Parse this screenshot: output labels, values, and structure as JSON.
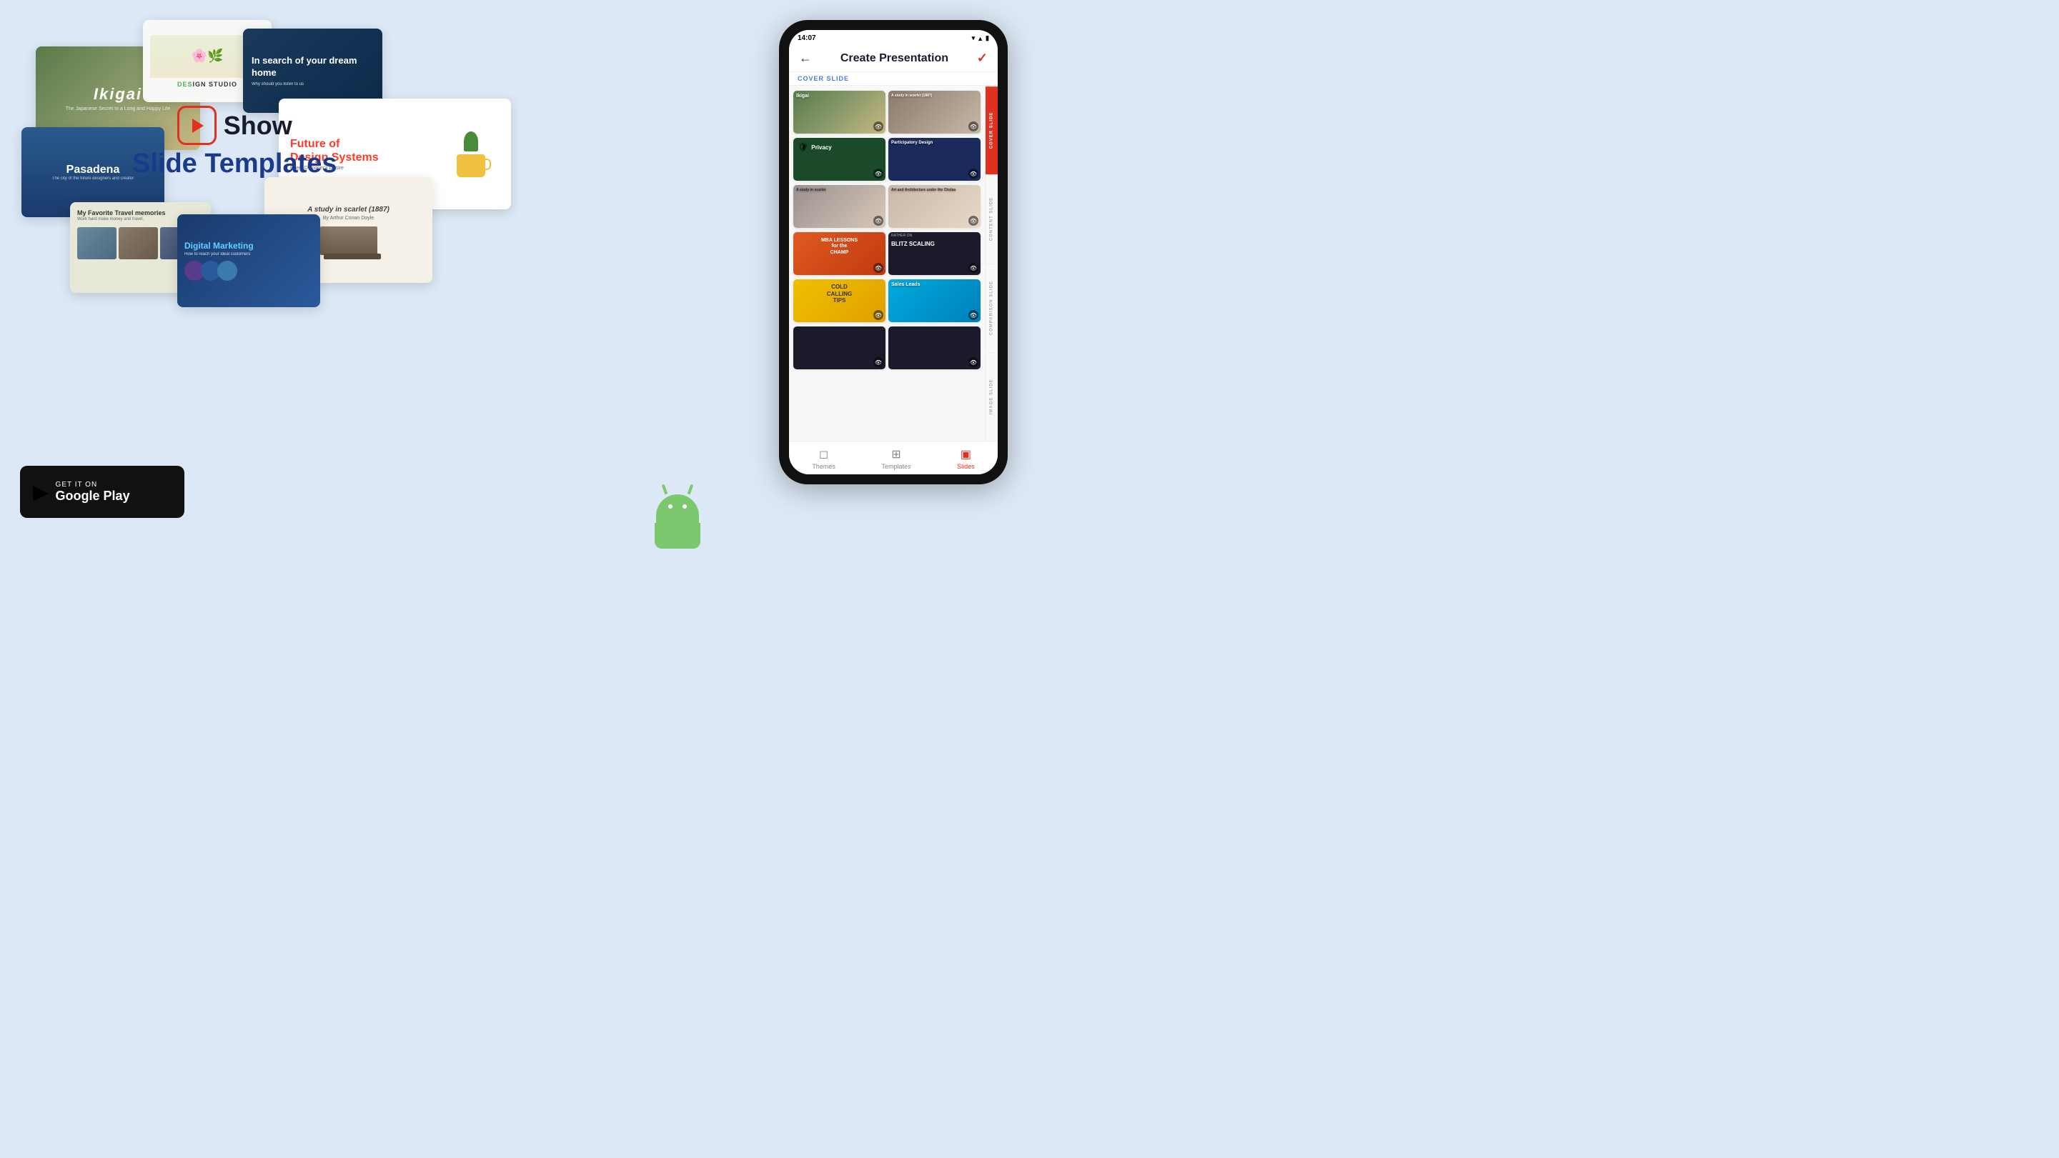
{
  "app": {
    "name": "Show",
    "tagline": "Slide Templates",
    "background_color": "#dce8f5"
  },
  "logo": {
    "play_icon_label": "▶",
    "show_label": "Show",
    "subtitle": "Slide Templates"
  },
  "google_play": {
    "get_it_on": "GET IT ON",
    "store_name": "Google Play"
  },
  "floating_slides": [
    {
      "id": "ikigai",
      "title": "Ikigai",
      "subtitle": "The Japanese Secret to a Long and Happy Life"
    },
    {
      "id": "design-studio",
      "label": "DESIGN STUDIO"
    },
    {
      "id": "dream-home",
      "title": "In search of your dream home"
    },
    {
      "id": "pasadena",
      "title": "Pasadena"
    },
    {
      "id": "future-design",
      "title": "Future of Design Systems",
      "subtitle": "Every Designer's Desire"
    },
    {
      "id": "travel-memories",
      "title": "My Favorite Travel memories",
      "subtitle": "Work hard make money and travel."
    },
    {
      "id": "scarlet",
      "title": "A study in scarlet (1887)",
      "subtitle": "By Arthur Conan Doyle"
    },
    {
      "id": "digital-marketing",
      "title": "Digital Marketing",
      "subtitle": "How to reach your ideal customers"
    }
  ],
  "phone": {
    "status_time": "14:07",
    "header_title": "Create Presentation",
    "section_cover": "COVER SLIDE",
    "sections": [
      {
        "label": "COVER SLIDE"
      },
      {
        "label": "CONTENT SLIDE"
      },
      {
        "label": "COMPARISON SLIDE"
      },
      {
        "label": "IMAGE SLIDE"
      }
    ],
    "slides": [
      {
        "id": "ikigai",
        "name": "Ikigai",
        "style": "s-ikigai"
      },
      {
        "id": "book",
        "name": "A study in scarlet (1887)",
        "style": "s-book"
      },
      {
        "id": "privacy",
        "name": "Privacy",
        "style": "s-privacy"
      },
      {
        "id": "participatory",
        "name": "Participatory Design",
        "style": "s-participatory"
      },
      {
        "id": "study2",
        "name": "A study in scarlet (1887)",
        "style": "s-study"
      },
      {
        "id": "art",
        "name": "Art and Architecture under the Cholas",
        "style": "s-art"
      },
      {
        "id": "mba",
        "name": "MBA LESSONS for the CHAMP",
        "style": "s-mba"
      },
      {
        "id": "blitz",
        "name": "BLITZ SCALING",
        "style": "s-blitz"
      },
      {
        "id": "cold",
        "name": "COLD CALLING TIPS",
        "style": "s-cold"
      },
      {
        "id": "sales",
        "name": "Sales Leads",
        "style": "s-sales"
      },
      {
        "id": "dark1",
        "name": "",
        "style": "s-dark1"
      },
      {
        "id": "dark2",
        "name": "",
        "style": "s-dark2"
      }
    ],
    "tabs": [
      {
        "id": "themes",
        "label": "Themes",
        "icon": "◻",
        "active": false
      },
      {
        "id": "templates",
        "label": "Templates",
        "icon": "⊞",
        "active": false
      },
      {
        "id": "slides",
        "label": "Slides",
        "icon": "▣",
        "active": true
      }
    ]
  }
}
